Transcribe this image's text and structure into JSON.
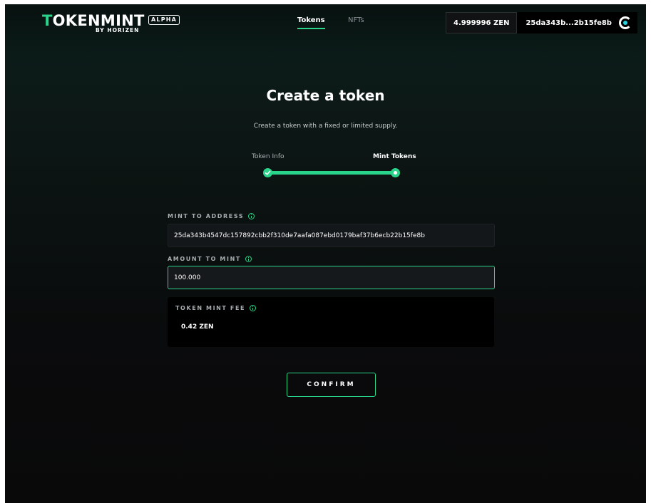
{
  "header": {
    "logo_prefix": "T",
    "logo_rest": "OKENMINT",
    "logo_sub": "BY HORIZEN",
    "badge": "ALPHA",
    "nav": [
      {
        "label": "Tokens",
        "active": true
      },
      {
        "label": "NFTs",
        "active": false
      }
    ],
    "balance": "4.999996 ZEN",
    "account": "25da343b...2b15fe8b",
    "wallet_icon": "horizen-logo-icon"
  },
  "main": {
    "title": "Create a token",
    "subtitle": "Create a token with a fixed or limited supply.",
    "steps": [
      {
        "label": "Token Info",
        "status": "completed"
      },
      {
        "label": "Mint Tokens",
        "status": "current"
      }
    ],
    "progress": 1.0,
    "mint_to_address": {
      "label": "MINT TO ADDRESS",
      "value": "25da343b4547dc157892cbb2f310de7aafa087ebd0179baf37b6ecb22b15fe8b"
    },
    "amount_to_mint": {
      "label": "AMOUNT TO MINT",
      "value": "100.000"
    },
    "fee": {
      "label": "TOKEN MINT FEE",
      "value": "0.42 ZEN"
    },
    "confirm_label": "CONFIRM"
  },
  "colors": {
    "accent": "#2ad48a",
    "background": "#0a0b0c"
  }
}
